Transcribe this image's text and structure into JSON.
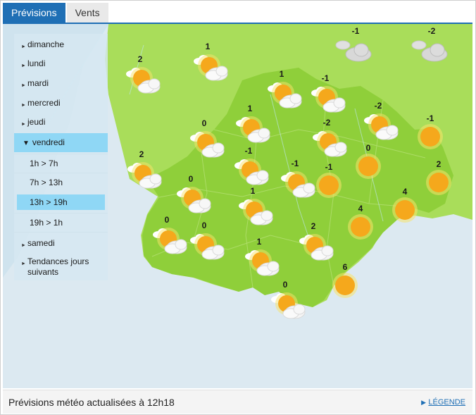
{
  "tabs": [
    {
      "label": "Prévisions",
      "active": true
    },
    {
      "label": "Vents",
      "active": false
    }
  ],
  "sidebar": {
    "days": [
      {
        "label": "dimanche"
      },
      {
        "label": "lundi"
      },
      {
        "label": "mardi"
      },
      {
        "label": "mercredi"
      },
      {
        "label": "jeudi"
      }
    ],
    "open_day": {
      "label": "vendredi"
    },
    "slots": [
      {
        "label": "1h > 7h"
      },
      {
        "label": "7h > 13h"
      },
      {
        "label": "13h > 19h",
        "selected": true
      },
      {
        "label": "19h > 1h"
      }
    ],
    "after_days": [
      {
        "label": "samedi"
      },
      {
        "label": "Tendances jours suivants"
      }
    ]
  },
  "forecasts": [
    {
      "t": "-1",
      "icon": "cloud-icon"
    },
    {
      "t": "-2",
      "icon": "cloud-icon"
    },
    {
      "t": "2",
      "icon": "partly-cloudy-icon"
    },
    {
      "t": "1",
      "icon": "partly-cloudy-icon"
    },
    {
      "t": "1",
      "icon": "partly-cloudy-icon"
    },
    {
      "t": "-1",
      "icon": "partly-cloudy-icon"
    },
    {
      "t": "1",
      "icon": "partly-cloudy-icon"
    },
    {
      "t": "-2",
      "icon": "partly-cloudy-icon"
    },
    {
      "t": "-1",
      "icon": "sun-icon"
    },
    {
      "t": "0",
      "icon": "partly-cloudy-icon"
    },
    {
      "t": "-2",
      "icon": "partly-cloudy-icon"
    },
    {
      "t": "0",
      "icon": "sun-icon"
    },
    {
      "t": "2",
      "icon": "partly-cloudy-icon"
    },
    {
      "t": "-1",
      "icon": "partly-cloudy-icon"
    },
    {
      "t": "-1",
      "icon": "partly-cloudy-icon"
    },
    {
      "t": "-1",
      "icon": "sun-icon"
    },
    {
      "t": "2",
      "icon": "sun-icon"
    },
    {
      "t": "0",
      "icon": "partly-cloudy-icon"
    },
    {
      "t": "1",
      "icon": "partly-cloudy-icon"
    },
    {
      "t": "4",
      "icon": "sun-icon"
    },
    {
      "t": "4",
      "icon": "sun-icon"
    },
    {
      "t": "0",
      "icon": "partly-cloudy-icon"
    },
    {
      "t": "0",
      "icon": "partly-cloudy-icon"
    },
    {
      "t": "2",
      "icon": "partly-cloudy-icon"
    },
    {
      "t": "1",
      "icon": "partly-cloudy-icon"
    },
    {
      "t": "6",
      "icon": "sun-icon"
    },
    {
      "t": "0",
      "icon": "partly-cloudy-icon"
    }
  ],
  "colors": {
    "land": "#8fcf3a",
    "land_outside": "#a9dd5a",
    "sea": "#dce9f1",
    "tab_active": "#1f6fb5",
    "highlight": "#8fd7f5",
    "sun": "#f5a81c"
  },
  "footer": {
    "status": "Prévisions météo actualisées à 12h18",
    "legend": "LÉGENDE"
  }
}
